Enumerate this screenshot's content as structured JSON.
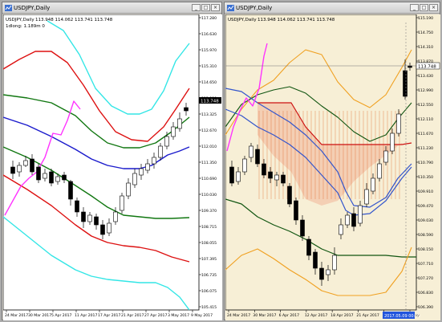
{
  "left_window": {
    "title": "USDJPY,Daily",
    "controls": {
      "minimize": "_",
      "maximize": "□",
      "close": "×"
    },
    "chart_data": {
      "type": "candlestick",
      "info_line": "USDJPY,Daily",
      "ohlc_text": "113.948 114.062 113.741 113.748",
      "legend": "1dlong: 1.189m 0",
      "price_label": "113.748",
      "y_ticks": [
        "117.280",
        "116.630",
        "115.970",
        "115.310",
        "114.650",
        "113.980",
        "113.325",
        "112.670",
        "112.010",
        "111.350",
        "110.690",
        "110.030",
        "109.370",
        "108.715",
        "108.055",
        "107.395",
        "106.735",
        "106.075",
        "105.415"
      ],
      "x_ticks": [
        "24 Mar 2017",
        "30 Mar 2017",
        "5 Apr 2017",
        "11 Apr 2017",
        "17 Apr 2017",
        "21 Apr 2017",
        "27 Apr 2017",
        "3 May 2017",
        "9 May 2017"
      ],
      "y_range": [
        105.3,
        117.3
      ],
      "colors": {
        "background": "#ffffff",
        "cyan": "#33e6e6",
        "red": "#dd1111",
        "green": "#117711",
        "blue": "#1a1acc",
        "magenta": "#ff33ff"
      }
    }
  },
  "right_window": {
    "title": "USDJPY,Daily",
    "controls": {
      "minimize": "_",
      "maximize": "□",
      "close": "×"
    },
    "chart_data": {
      "type": "candlestick",
      "info_line": "USDJPY,Daily",
      "ohlc_text": "113.948 114.062 113.741 113.748",
      "price_label": "113.748",
      "y_ticks": [
        "115.190",
        "114.750",
        "114.310",
        "113.870",
        "113.430",
        "112.990",
        "112.550",
        "112.110",
        "111.670",
        "111.230",
        "110.790",
        "110.350",
        "109.910",
        "109.470",
        "109.030",
        "108.590",
        "108.150",
        "107.710",
        "107.270",
        "106.830",
        "106.390"
      ],
      "x_ticks": [
        "24 Mar 2017",
        "30 Mar 2017",
        "6 Apr 2017",
        "12 Apr 2017",
        "18 Apr 2017",
        "21 Apr 2017",
        "27 Apr 2017",
        "3 May"
      ],
      "x_highlight": "2017.05.09 00:00",
      "y_range": [
        106.2,
        115.4
      ],
      "colors": {
        "background": "#f7efd6",
        "orange": "#f0a020",
        "darkgreen": "#115511",
        "blue": "#3355cc",
        "red": "#cc1111",
        "magenta": "#ff33ff",
        "cloud": "#e06020"
      }
    }
  }
}
